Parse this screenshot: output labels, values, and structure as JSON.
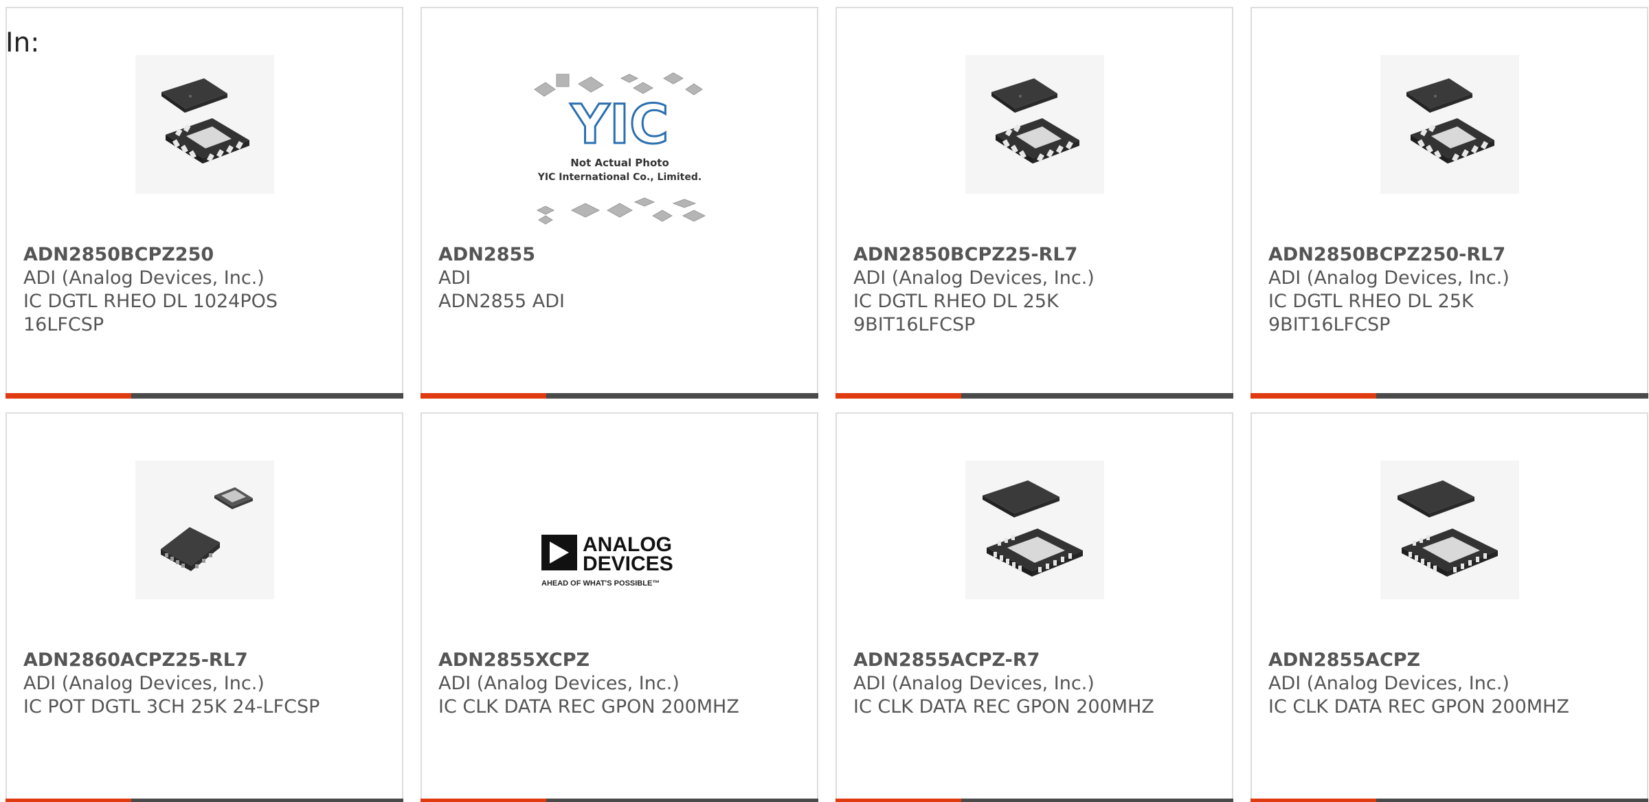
{
  "header": {
    "in_label": "In:"
  },
  "products": [
    {
      "part_number": "ADN2850BCPZ250",
      "manufacturer": "ADI (Analog Devices, Inc.)",
      "description": "IC DGTL RHEO DL 1024POS\n16LFCSP",
      "image": "chip-qfn16-icon"
    },
    {
      "part_number": "ADN2855",
      "manufacturer": "ADI",
      "description": "ADN2855 ADI",
      "image": "not-actual-photo-placeholder",
      "placeholder_text_1": "Not Actual Photo",
      "placeholder_text_2": "YIC International Co., Limited.",
      "placeholder_logo": "YIC"
    },
    {
      "part_number": "ADN2850BCPZ25-RL7",
      "manufacturer": "ADI (Analog Devices, Inc.)",
      "description": "IC DGTL RHEO DL 25K\n9BIT16LFCSP",
      "image": "chip-qfn16-icon"
    },
    {
      "part_number": "ADN2850BCPZ250-RL7",
      "manufacturer": "ADI (Analog Devices, Inc.)",
      "description": "IC DGTL RHEO DL 25K\n9BIT16LFCSP",
      "image": "chip-qfn16-icon"
    },
    {
      "part_number": "ADN2860ACPZ25-RL7",
      "manufacturer": "ADI (Analog Devices, Inc.)",
      "description": "IC POT DGTL 3CH 25K 24-LFCSP",
      "image": "chip-lfcsp24-icon"
    },
    {
      "part_number": "ADN2855XCPZ",
      "manufacturer": "ADI (Analog Devices, Inc.)",
      "description": "IC CLK DATA REC GPON 200MHZ",
      "image": "analog-devices-logo",
      "logo_line_1": "ANALOG",
      "logo_line_2": "DEVICES",
      "logo_tagline": "AHEAD OF WHAT'S POSSIBLE™"
    },
    {
      "part_number": "ADN2855ACPZ-R7",
      "manufacturer": "ADI (Analog Devices, Inc.)",
      "description": "IC CLK DATA REC GPON 200MHZ",
      "image": "chip-qfn32-icon"
    },
    {
      "part_number": "ADN2855ACPZ",
      "manufacturer": "ADI (Analog Devices, Inc.)",
      "description": "IC CLK DATA REC GPON 200MHZ",
      "image": "chip-qfn32-icon"
    }
  ],
  "colors": {
    "accent": "#e03a10",
    "bar": "#4a4a4a",
    "text": "#555555",
    "border": "#dddddd"
  }
}
